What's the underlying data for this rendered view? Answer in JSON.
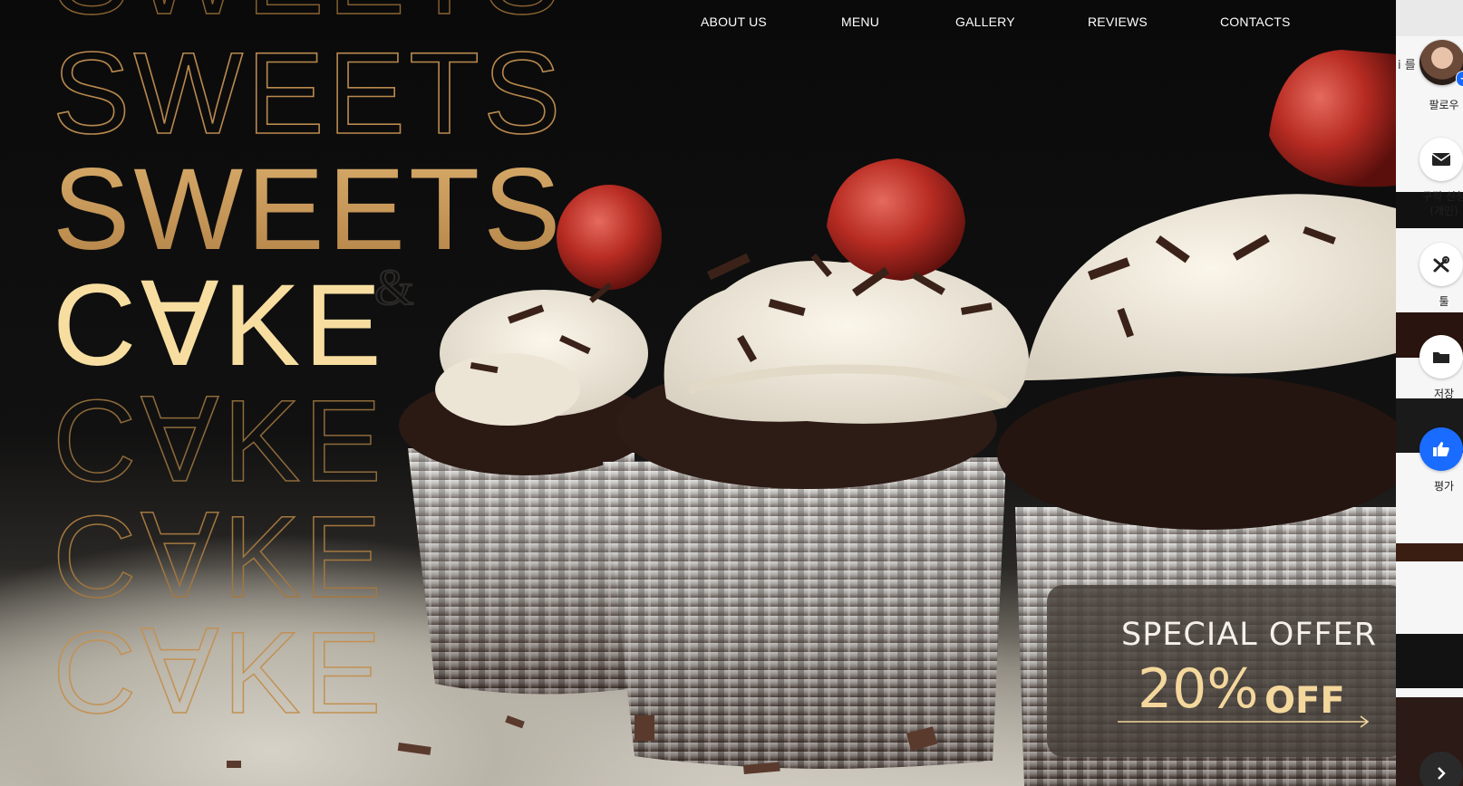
{
  "nav": {
    "items": [
      "ABOUT US",
      "MENU",
      "GALLERY",
      "REVIEWS",
      "CONTACTS"
    ]
  },
  "hero": {
    "word_sweets": "SWEETS",
    "word_cake": "C∀KE",
    "ampersand": "&"
  },
  "offer": {
    "title": "SPECIAL OFFER",
    "percent": "20%",
    "off": "OFF"
  },
  "sidepanel": {
    "partial_text": "i 를",
    "follow_label": "팔로우",
    "apply_label_1": "구직 신청",
    "apply_label_2": "(개인)",
    "tools_label": "툴",
    "save_label": "저장",
    "rate_label": "평가",
    "icons": [
      "mail-icon",
      "tools-icon",
      "folder-icon",
      "thumbs-up-icon",
      "chevron-right-icon"
    ]
  },
  "colors": {
    "gold_dark": "#8a6432",
    "gold_mid": "#c9995a",
    "cream": "#f7dea0",
    "offer_gold": "#f3d79c",
    "accent_blue": "#1a6bff"
  }
}
